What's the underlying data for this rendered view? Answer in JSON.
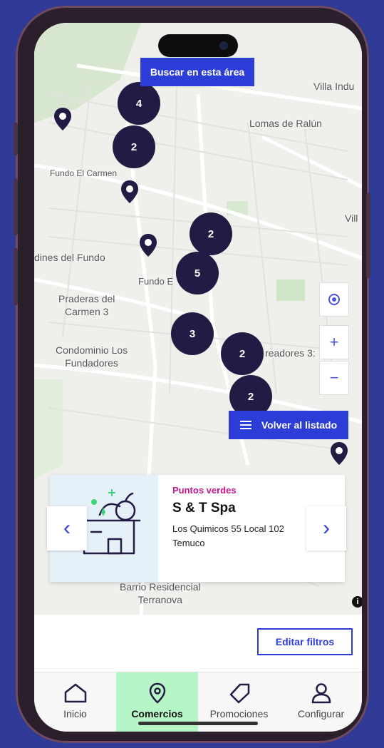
{
  "map": {
    "search_area_button": "Buscar en esta área",
    "labels": [
      "Villa Indu",
      "Lomas de Ralún",
      "Fundo El Carmen",
      "Vill",
      "dines del Fundo",
      "Fundo E",
      "Praderas del\nCarmen 3",
      "Condominio Los\nFundadores",
      "readores 3:",
      "Barrio Residencial\nTerranova"
    ],
    "clusters": [
      "4",
      "2",
      "2",
      "5",
      "3",
      "2",
      "2"
    ],
    "back_to_list_button": "Volver al listado",
    "zoom_in": "+",
    "zoom_out": "−",
    "info": "i"
  },
  "card": {
    "category": "Puntos verdes",
    "name": "S & T Spa",
    "address_line1": "Los Quimicos 55 Local 102",
    "address_line2": "Temuco",
    "prev": "‹",
    "next": "›"
  },
  "filters_button": "Editar filtros",
  "tabs": [
    {
      "label": "Inicio",
      "icon": "home-icon"
    },
    {
      "label": "Comercios",
      "icon": "location-pin-icon"
    },
    {
      "label": "Promociones",
      "icon": "tag-icon"
    },
    {
      "label": "Configurar",
      "icon": "user-icon"
    }
  ],
  "colors": {
    "background": "#2f3b96",
    "primary": "#2d3dd8",
    "cluster": "#231b44",
    "category": "#c4168e",
    "active_tab": "#b6f5c6"
  }
}
